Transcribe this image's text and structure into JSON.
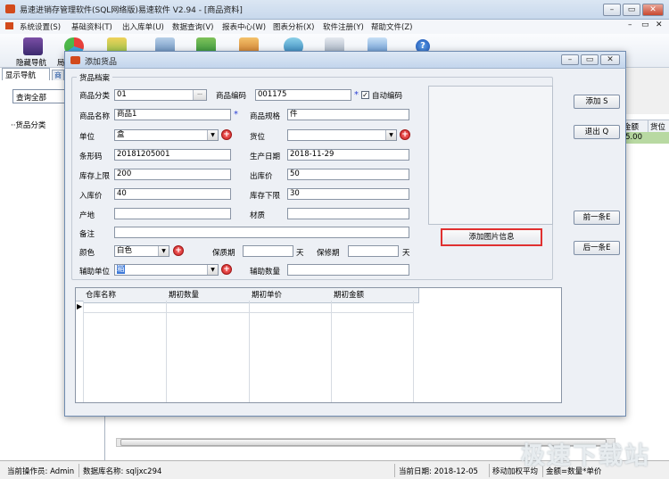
{
  "window": {
    "title": "易速进销存管理软件(SQL网络版)易速软件 V2.94 - [商品资料]"
  },
  "menu": [
    "系统设置(S)",
    "基础资料(T)",
    "出入库单(U)",
    "数据查询(V)",
    "报表中心(W)",
    "图表分析(X)",
    "软件注册(Y)",
    "帮助文件(Z)"
  ],
  "toolbar": {
    "first_label": "隐藏导航",
    "second_label": "局"
  },
  "sidebar": {
    "tab_label": "显示导航",
    "tab2_label": "商",
    "select_all": "查询全部",
    "tree_root": "货品分类"
  },
  "grid": {
    "headers": [
      "金额",
      "货位"
    ],
    "row_value": "-5.00"
  },
  "dialog": {
    "title": "添加货品",
    "section": "货品档案",
    "fields": {
      "category": {
        "label": "商品分类",
        "value": "01"
      },
      "code": {
        "label": "商品编码",
        "value": "001175"
      },
      "auto_code": "自动编码",
      "name": {
        "label": "商品名称",
        "value": "商品1"
      },
      "spec": {
        "label": "商品规格",
        "value": "件"
      },
      "unit": {
        "label": "单位",
        "value": "盒"
      },
      "location": {
        "label": "货位",
        "value": ""
      },
      "barcode": {
        "label": "条形码",
        "value": "20181205001"
      },
      "prod_date": {
        "label": "生产日期",
        "value": "2018-11-29"
      },
      "stock_max": {
        "label": "库存上限",
        "value": "200"
      },
      "out_price": {
        "label": "出库价",
        "value": "50"
      },
      "in_price": {
        "label": "入库价",
        "value": "40"
      },
      "stock_min": {
        "label": "库存下限",
        "value": "30"
      },
      "origin": {
        "label": "产地",
        "value": ""
      },
      "material": {
        "label": "材质",
        "value": ""
      },
      "remark": {
        "label": "备注",
        "value": ""
      },
      "color": {
        "label": "颜色",
        "value": "白色"
      },
      "shelf_life": {
        "label": "保质期",
        "value": "",
        "unit": "天"
      },
      "warranty": {
        "label": "保修期",
        "value": "",
        "unit": "天"
      },
      "aux_unit": {
        "label": "辅助单位",
        "value": "箱"
      },
      "aux_qty": {
        "label": "辅助数量",
        "value": ""
      }
    },
    "photo_button": "添加图片信息",
    "buttons": {
      "add": "添加 S",
      "exit": "退出 Q",
      "prev": "前一条E",
      "next": "后一条E"
    },
    "warehouse_headers": [
      "仓库名称",
      "期初数量",
      "期初单价",
      "期初金额"
    ]
  },
  "status": {
    "operator": "当前操作员: Admin",
    "db": "数据库名称: sqljxc294",
    "date": "当前日期: 2018-12-05",
    "method": "移动加权平均",
    "formula": "金额=数量*单价"
  },
  "watermark": "极速下载站"
}
